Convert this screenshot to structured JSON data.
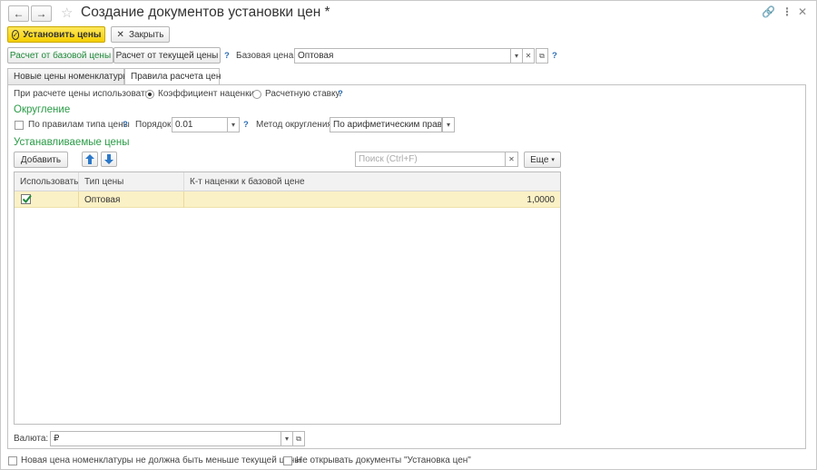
{
  "window": {
    "title": "Создание документов установки цен *",
    "back_icon": "arrow-left-icon",
    "forward_icon": "arrow-right-icon",
    "favorite_icon": "star-icon",
    "link_icon": "link-icon",
    "menu_icon": "more-vertical-icon",
    "close_icon": "close-icon"
  },
  "toolbar": {
    "set_prices_label": "Установить цены",
    "close_label": "Закрыть"
  },
  "calc_bar": {
    "from_base_label": "Расчет от базовой цены",
    "from_current_label": "Расчет от текущей цены",
    "help": "?",
    "base_price_label": "Базовая цена:",
    "base_price_value": "Оптовая",
    "base_help": "?"
  },
  "tabs": [
    {
      "label": "Новые цены номенклатуры",
      "active": false
    },
    {
      "label": "Правила расчета цен",
      "active": true
    }
  ],
  "rules": {
    "use_label": "При расчете цены использовать:",
    "option_markup": "Коэффициент наценки",
    "option_rate": "Расчетную ставку",
    "option_help": "?",
    "selected": "markup"
  },
  "rounding": {
    "title": "Округление",
    "by_type_label": "По правилам типа цены",
    "by_type_help": "?",
    "order_label": "Порядок:",
    "order_value": "0.01",
    "order_help": "?",
    "method_label": "Метод округления:",
    "method_value": "По арифметическим правилам"
  },
  "prices": {
    "title": "Устанавливаемые цены",
    "add_label": "Добавить",
    "search_placeholder": "Поиск (Ctrl+F)",
    "more_label": "Еще",
    "columns": [
      "Использовать",
      "Тип цены",
      "К-т наценки к базовой цене"
    ],
    "rows": [
      {
        "use": true,
        "type": "Оптовая",
        "coef": "1,0000"
      }
    ]
  },
  "currency": {
    "label": "Валюта:",
    "value": "₽"
  },
  "footer": {
    "not_less_label": "Новая цена номенклатуры не должна быть меньше текущей цены",
    "not_open_label": "Не открывать документы \"Установка цен\""
  },
  "colors": {
    "primary_button": "#f5cf00",
    "accent_green": "#2a9b46",
    "selected_row": "#fbf1c6",
    "help_blue": "#2c6eb5"
  }
}
